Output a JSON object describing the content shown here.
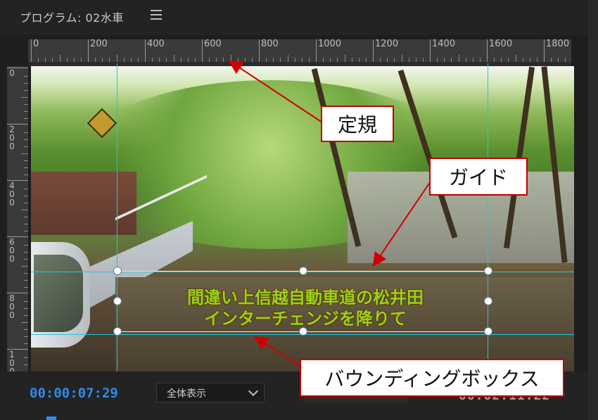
{
  "panel": {
    "title": "プログラム: 02水車"
  },
  "ruler_top": {
    "labels": [
      "0",
      "200",
      "400",
      "600",
      "800",
      "1000",
      "1200",
      "1400",
      "1600",
      "1800"
    ]
  },
  "ruler_left": {
    "labels": [
      "0",
      "200",
      "400",
      "600",
      "800",
      "100"
    ]
  },
  "caption": {
    "line1": "間違い上信越自動車道の松井田",
    "line2": "インターチェンジを降りて",
    "color": "#9ad11a"
  },
  "annotations": {
    "ruler_callout": "定規",
    "guide_callout": "ガイド",
    "bbox_callout": "バウンディングボックス",
    "callout_border": "#c00000"
  },
  "footer": {
    "timecode": "00:00:07:29",
    "zoom_value": "全体表示",
    "duration": "00:02:11:22"
  },
  "colors": {
    "guide": "#1ec8e0",
    "timecode": "#2d8ceb"
  }
}
